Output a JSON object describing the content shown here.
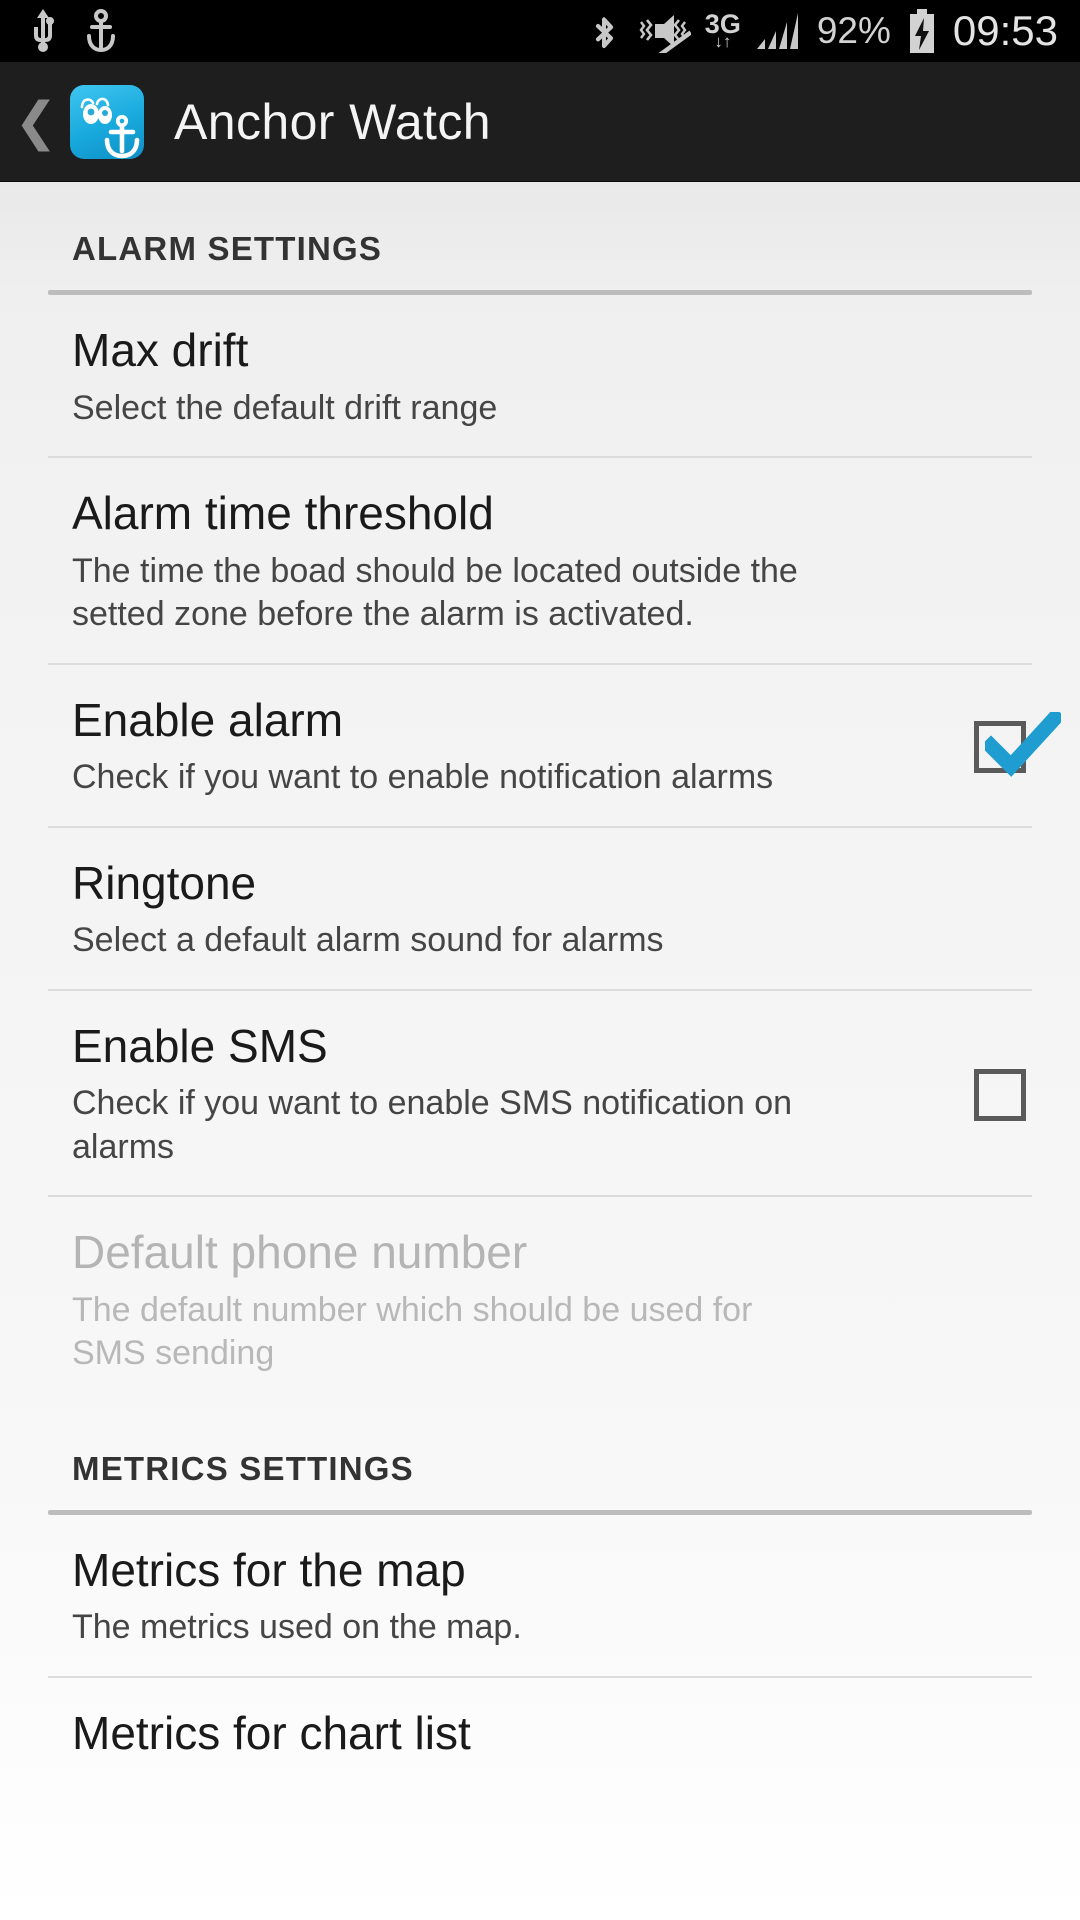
{
  "statusbar": {
    "left_icons": [
      "usb-icon",
      "anchor-icon"
    ],
    "right_icons": [
      "bluetooth-icon",
      "vibrate-mute-icon",
      "signal-bars-icon",
      "battery-charging-icon"
    ],
    "network_label": "3G",
    "data_arrows": "↓↑",
    "battery_percent": "92%",
    "clock": "09:53"
  },
  "actionbar": {
    "back_icon": "back-chevron-icon",
    "app_icon": "anchor-watch-app-icon",
    "title": "Anchor Watch"
  },
  "colors": {
    "accent": "#1f9cd0",
    "app_icon_bg": "#18a9dd",
    "actionbar_bg": "#1e1e1e",
    "statusbar_bg": "#000000",
    "content_bg": "#f2f2f2",
    "checkbox_border": "#5a5a5a",
    "divider": "#dcdcdc",
    "section_rule": "#bdbdbd",
    "disabled_text": "#b4b4b4"
  },
  "sections": [
    {
      "header": "ALARM SETTINGS",
      "items": [
        {
          "title": "Max drift",
          "summary": "Select the default drift range",
          "widget": "none",
          "enabled": true
        },
        {
          "title": "Alarm time threshold",
          "summary": "The time the boad should be located outside the setted zone before the alarm is activated.",
          "widget": "none",
          "enabled": true
        },
        {
          "title": "Enable alarm",
          "summary": "Check if you want to enable notification alarms",
          "widget": "checkbox",
          "checked": true,
          "enabled": true
        },
        {
          "title": "Ringtone",
          "summary": "Select a default alarm sound for alarms",
          "widget": "none",
          "enabled": true
        },
        {
          "title": "Enable SMS",
          "summary": "Check if you want to enable SMS notification on alarms",
          "widget": "checkbox",
          "checked": false,
          "enabled": true
        },
        {
          "title": "Default phone number",
          "summary": "The default number which should be used for SMS sending",
          "widget": "none",
          "enabled": false
        }
      ]
    },
    {
      "header": "METRICS SETTINGS",
      "items": [
        {
          "title": "Metrics for the map",
          "summary": "The metrics used on the map.",
          "widget": "none",
          "enabled": true
        },
        {
          "title": "Metrics for chart list",
          "summary": "",
          "widget": "none",
          "enabled": true,
          "clipped": true
        }
      ]
    }
  ]
}
